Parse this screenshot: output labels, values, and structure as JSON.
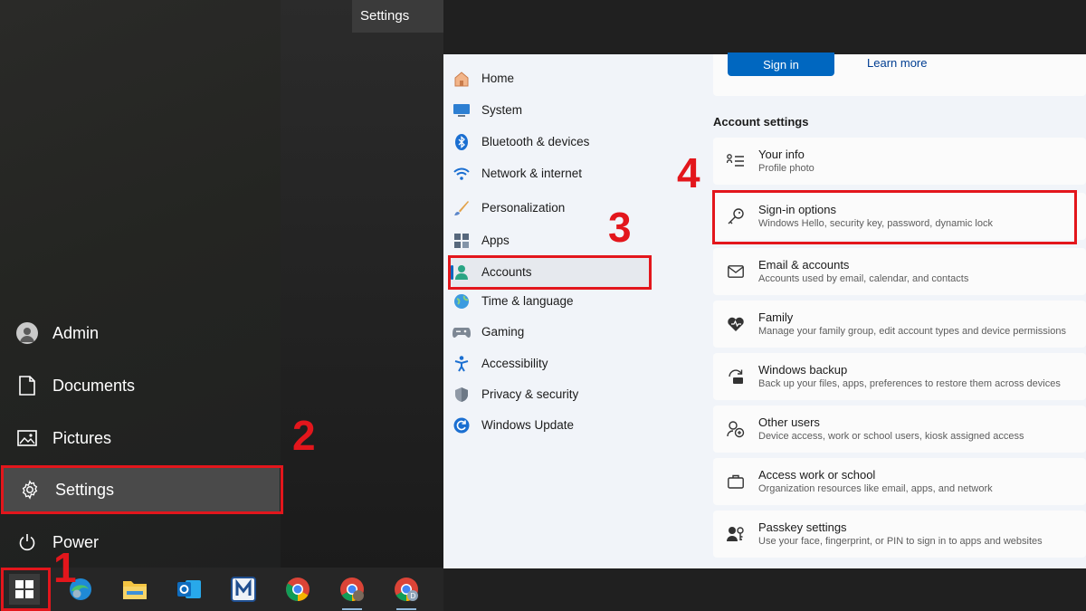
{
  "start_menu": {
    "tooltip": "Settings",
    "items": [
      {
        "label": "Admin",
        "icon": "user-avatar-icon"
      },
      {
        "label": "Documents",
        "icon": "document-icon"
      },
      {
        "label": "Pictures",
        "icon": "pictures-icon"
      },
      {
        "label": "Settings",
        "icon": "gear-icon",
        "active": true
      },
      {
        "label": "Power",
        "icon": "power-icon"
      }
    ]
  },
  "taskbar": {
    "apps": [
      "windows-start-icon",
      "edge-icon",
      "file-explorer-icon",
      "outlook-icon",
      "m-app-icon",
      "chrome-icon",
      "chrome-profile-icon",
      "chrome-profile-d-icon"
    ]
  },
  "settings": {
    "nav": [
      {
        "label": "Home",
        "icon": "home-icon"
      },
      {
        "label": "System",
        "icon": "system-icon"
      },
      {
        "label": "Bluetooth & devices",
        "icon": "bluetooth-icon"
      },
      {
        "label": "Network & internet",
        "icon": "wifi-icon"
      },
      {
        "label": "Personalization",
        "icon": "brush-icon"
      },
      {
        "label": "Apps",
        "icon": "apps-icon"
      },
      {
        "label": "Accounts",
        "icon": "accounts-icon",
        "selected": true
      },
      {
        "label": "Time & language",
        "icon": "globe-icon"
      },
      {
        "label": "Gaming",
        "icon": "gamepad-icon"
      },
      {
        "label": "Accessibility",
        "icon": "accessibility-icon"
      },
      {
        "label": "Privacy & security",
        "icon": "shield-icon"
      },
      {
        "label": "Windows Update",
        "icon": "windows-update-icon"
      }
    ],
    "top_card": {
      "signin_label": "Sign in",
      "learn_more_label": "Learn more"
    },
    "section_title": "Account settings",
    "cards": [
      {
        "title": "Your info",
        "subtitle": "Profile photo",
        "icon": "your-info-icon"
      },
      {
        "title": "Sign-in options",
        "subtitle": "Windows Hello, security key, password, dynamic lock",
        "icon": "key-icon"
      },
      {
        "title": "Email & accounts",
        "subtitle": "Accounts used by email, calendar, and contacts",
        "icon": "mail-icon"
      },
      {
        "title": "Family",
        "subtitle": "Manage your family group, edit account types and device permissions",
        "icon": "family-heart-icon"
      },
      {
        "title": "Windows backup",
        "subtitle": "Back up your files, apps, preferences to restore them across devices",
        "icon": "backup-icon"
      },
      {
        "title": "Other users",
        "subtitle": "Device access, work or school users, kiosk assigned access",
        "icon": "other-users-icon"
      },
      {
        "title": "Access work or school",
        "subtitle": "Organization resources like email, apps, and network",
        "icon": "briefcase-icon"
      },
      {
        "title": "Passkey settings",
        "subtitle": "Use your face, fingerprint, or PIN to sign in to apps and websites",
        "icon": "passkey-icon"
      }
    ]
  },
  "annotations": {
    "step_1": "1",
    "step_2": "2",
    "step_3": "3",
    "step_4": "4",
    "color": "#e3161c"
  },
  "colors": {
    "accent": "#0067c0",
    "annotation": "#e3161c"
  }
}
